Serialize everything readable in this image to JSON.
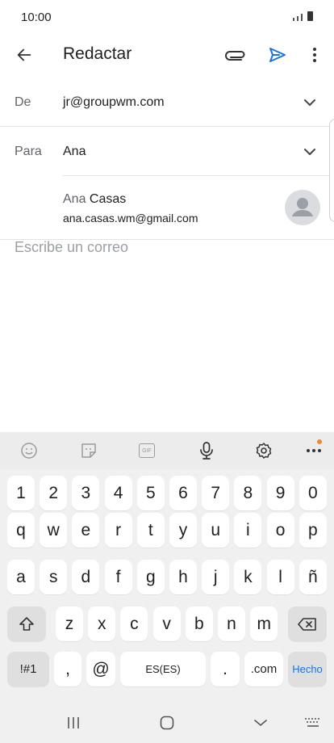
{
  "status": {
    "time": "10:00"
  },
  "appbar": {
    "title": "Redactar",
    "icons": [
      "back-arrow-icon",
      "paperclip-icon",
      "send-icon",
      "more-vert-icon"
    ],
    "accent": "#1a73e8"
  },
  "from": {
    "label": "De",
    "value": "jr@groupwm.com"
  },
  "to": {
    "label": "Para",
    "value": "Ana"
  },
  "suggestion": {
    "name_prefix": "Ana",
    "name_rest": "Casas",
    "email": "ana.casas.wm@gmail.com"
  },
  "body": {
    "placeholder": "Escribe un correo"
  },
  "keyboard": {
    "toolbar_icons": [
      "emoji-icon",
      "sticker-icon",
      "gif-icon",
      "mic-icon",
      "settings-icon",
      "more-horiz-icon"
    ],
    "gif_label": "GIF",
    "row_numbers": [
      "1",
      "2",
      "3",
      "4",
      "5",
      "6",
      "7",
      "8",
      "9",
      "0"
    ],
    "row1": [
      "q",
      "w",
      "e",
      "r",
      "t",
      "y",
      "u",
      "i",
      "o",
      "p"
    ],
    "row2": [
      "a",
      "s",
      "d",
      "f",
      "g",
      "h",
      "j",
      "k",
      "l",
      "ñ"
    ],
    "row3": [
      "z",
      "x",
      "c",
      "v",
      "b",
      "n",
      "m"
    ],
    "symbols_key": "!#1",
    "comma_key": ",",
    "at_key": "@",
    "space_key": "ES(ES)",
    "period_key": ".",
    "com_key": ".com",
    "done_key": "Hecho"
  },
  "navbar": {
    "icons": [
      "recent-apps-icon",
      "home-icon",
      "back-chevron-icon",
      "keyboard-icon"
    ]
  }
}
